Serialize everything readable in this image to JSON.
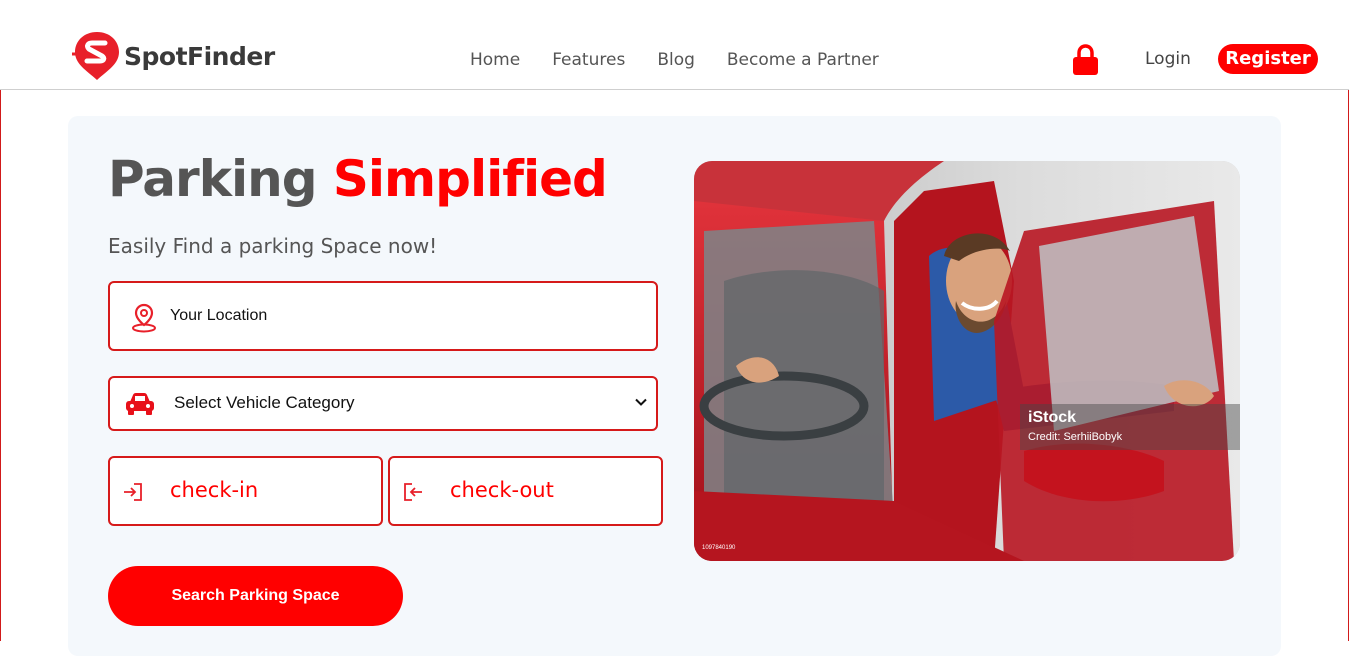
{
  "brand": {
    "name": "SpotFinder",
    "logo_icon": "spotfinder-logo-icon"
  },
  "nav": {
    "items": [
      {
        "label": "Home"
      },
      {
        "label": "Features"
      },
      {
        "label": "Blog"
      },
      {
        "label": "Become a Partner"
      }
    ]
  },
  "account": {
    "lock_icon": "lock-icon",
    "login_label": "Login",
    "register_label": "Register"
  },
  "hero": {
    "title_main": "Parking",
    "title_accent": "Simplified",
    "subtitle": "Easily Find a parking Space now!",
    "location": {
      "placeholder": "Your Location",
      "icon": "location-pin-icon"
    },
    "vehicle": {
      "selected": "Select Vehicle Category",
      "icon": "car-icon"
    },
    "checkin": {
      "label": "check-in",
      "icon": "sign-in-icon"
    },
    "checkout": {
      "label": "check-out",
      "icon": "sign-out-icon"
    },
    "search_label": "Search Parking Space",
    "photo": {
      "watermark_brand": "iStock",
      "watermark_credit": "Credit: SerhiiBobyk",
      "stock_id": "1097840190"
    }
  },
  "colors": {
    "accent": "#ff0000",
    "border": "#d61a1a",
    "hero_bg": "#f4f8fc",
    "text": "#555555"
  }
}
